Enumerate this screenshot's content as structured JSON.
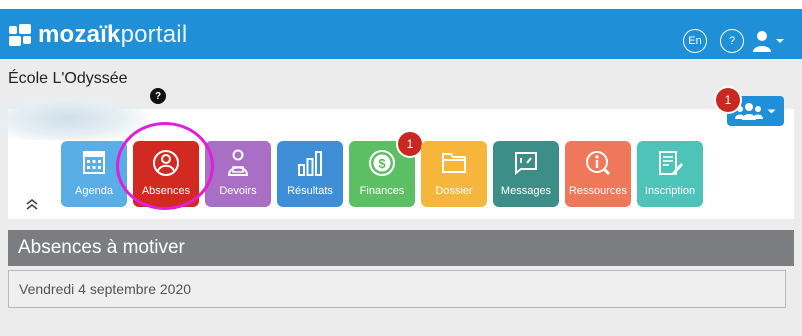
{
  "app": {
    "logo_bold": "mozaïk",
    "logo_light": "portail",
    "lang_label": "En",
    "help_label": "?"
  },
  "school": {
    "name": "École L'Odyssée"
  },
  "help_badge": "?",
  "group_badge": "1",
  "tiles": [
    {
      "label": "Agenda",
      "color": "#5aaee8",
      "icon": "calendar-icon"
    },
    {
      "label": "Absences",
      "color": "#d22a21",
      "icon": "absence-person-icon"
    },
    {
      "label": "Devoirs",
      "color": "#a86fc4",
      "icon": "homework-person-icon"
    },
    {
      "label": "Résultats",
      "color": "#3f8fd8",
      "icon": "bar-chart-icon"
    },
    {
      "label": "Finances",
      "color": "#5dbf64",
      "icon": "dollar-coin-icon",
      "badge": "1"
    },
    {
      "label": "Dossier",
      "color": "#f6b63b",
      "icon": "folder-icon"
    },
    {
      "label": "Messages",
      "color": "#3b8f88",
      "icon": "message-icon"
    },
    {
      "label": "Ressources",
      "color": "#f0785a",
      "icon": "resources-icon"
    },
    {
      "label": "Inscription",
      "color": "#4ec3b8",
      "icon": "inscription-form-icon"
    }
  ],
  "section": {
    "title": "Absences à motiver"
  },
  "date_label": "Vendredi 4 septembre 2020",
  "colors": {
    "topbar": "#1f8fd8",
    "highlight": "#e11ed8",
    "badge": "#c8281f",
    "section_header": "#7b7d80"
  }
}
